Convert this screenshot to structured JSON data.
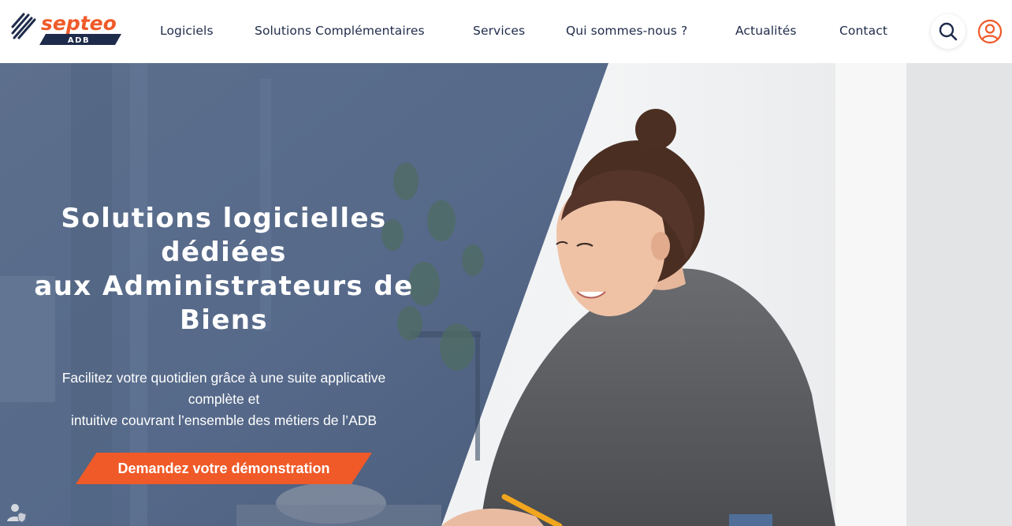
{
  "brand": {
    "name": "septeo",
    "sub": "ADB",
    "colors": {
      "orange": "#ef5a28",
      "navy": "#1e2b4a"
    }
  },
  "nav": {
    "items": [
      {
        "label": "Logiciels"
      },
      {
        "label": "Solutions Complémentaires"
      },
      {
        "label": "Services"
      },
      {
        "label": "Qui sommes-nous ?"
      },
      {
        "label": "Actualités"
      },
      {
        "label": "Contact"
      }
    ]
  },
  "header_icons": {
    "search": "search-icon",
    "account": "user-icon"
  },
  "hero": {
    "title_lines": [
      "Solutions logicielles",
      "dédiées",
      "aux Administrateurs de",
      "Biens"
    ],
    "subtitle_lines": [
      "Facilitez votre quotidien grâce à une suite applicative",
      "complète et",
      "intuitive couvrant l’ensemble des métiers de l’ADB"
    ],
    "cta_label": "Demandez votre démonstration"
  },
  "cookie_icon": "user-privacy-icon"
}
